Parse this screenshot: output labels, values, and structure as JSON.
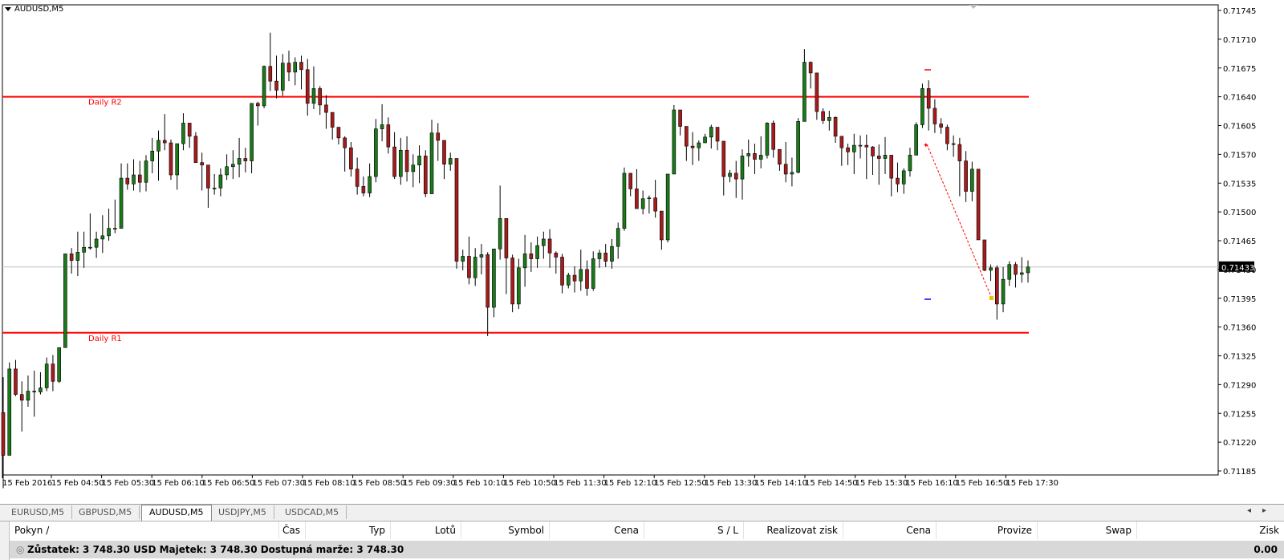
{
  "chart": {
    "symbol_title": "AUDUSD,M5",
    "colors": {
      "bull": "#1a7a1a",
      "bear": "#a61c1c",
      "wick": "#000000",
      "level": "#ff0000",
      "bid_line": "#c0c0c0"
    },
    "price_axis_labels": [
      "0.71745",
      "0.71710",
      "0.71675",
      "0.71640",
      "0.71605",
      "0.71570",
      "0.71535",
      "0.71500",
      "0.71465",
      "0.71430",
      "0.71395",
      "0.71360",
      "0.71325",
      "0.71290",
      "0.71255",
      "0.71220",
      "0.71185"
    ],
    "current_price": "0.71433",
    "time_axis_labels": [
      "15 Feb 2016",
      "15 Feb 04:50",
      "15 Feb 05:30",
      "15 Feb 06:10",
      "15 Feb 06:50",
      "15 Feb 07:30",
      "15 Feb 08:10",
      "15 Feb 08:50",
      "15 Feb 09:30",
      "15 Feb 10:10",
      "15 Feb 10:50",
      "15 Feb 11:30",
      "15 Feb 12:10",
      "15 Feb 12:50",
      "15 Feb 13:30",
      "15 Feb 14:10",
      "15 Feb 14:50",
      "15 Feb 15:30",
      "15 Feb 16:10",
      "15 Feb 16:50",
      "15 Feb 17:30"
    ],
    "levels": [
      {
        "label": "Daily R2",
        "price": 0.7164
      },
      {
        "label": "Daily R1",
        "price": 0.71353
      }
    ],
    "candles": [
      [
        0.71256,
        0.71299,
        0.71164,
        0.71204
      ],
      [
        0.71204,
        0.71317,
        0.71254,
        0.71309
      ],
      [
        0.71309,
        0.7132,
        0.71276,
        0.71278
      ],
      [
        0.71278,
        0.71294,
        0.71233,
        0.71271
      ],
      [
        0.71271,
        0.71301,
        0.71263,
        0.71282
      ],
      [
        0.71282,
        0.71307,
        0.71251,
        0.71281
      ],
      [
        0.71281,
        0.71305,
        0.71278,
        0.71286
      ],
      [
        0.71286,
        0.71323,
        0.71282,
        0.71315
      ],
      [
        0.71315,
        0.71326,
        0.71282,
        0.71294
      ],
      [
        0.71294,
        0.71335,
        0.71292,
        0.71335
      ],
      [
        0.71335,
        0.71449,
        0.71339,
        0.71449
      ],
      [
        0.71449,
        0.71456,
        0.71425,
        0.71441
      ],
      [
        0.71441,
        0.71476,
        0.71422,
        0.71451
      ],
      [
        0.71451,
        0.71476,
        0.71432,
        0.71457
      ],
      [
        0.71457,
        0.71498,
        0.71454,
        0.71457
      ],
      [
        0.71457,
        0.71476,
        0.71444,
        0.71467
      ],
      [
        0.71467,
        0.71496,
        0.7145,
        0.71471
      ],
      [
        0.71471,
        0.71504,
        0.71465,
        0.7148
      ],
      [
        0.7148,
        0.71515,
        0.71474,
        0.7148
      ],
      [
        0.7148,
        0.71559,
        0.7148,
        0.71541
      ],
      [
        0.71541,
        0.71559,
        0.71527,
        0.71534
      ],
      [
        0.71534,
        0.71564,
        0.71526,
        0.71545
      ],
      [
        0.71545,
        0.71562,
        0.71524,
        0.71536
      ],
      [
        0.71536,
        0.71569,
        0.71525,
        0.71562
      ],
      [
        0.71562,
        0.7159,
        0.71547,
        0.71574
      ],
      [
        0.71574,
        0.71599,
        0.71538,
        0.71587
      ],
      [
        0.71587,
        0.71619,
        0.71575,
        0.71584
      ],
      [
        0.71584,
        0.71588,
        0.71539,
        0.71545
      ],
      [
        0.71545,
        0.71579,
        0.71527,
        0.71583
      ],
      [
        0.71583,
        0.7162,
        0.71575,
        0.71608
      ],
      [
        0.71608,
        0.71606,
        0.71578,
        0.71592
      ],
      [
        0.71592,
        0.71597,
        0.71561,
        0.7156
      ],
      [
        0.7156,
        0.71572,
        0.71526,
        0.71557
      ],
      [
        0.71557,
        0.71557,
        0.71505,
        0.71529
      ],
      [
        0.71529,
        0.71546,
        0.71521,
        0.71529
      ],
      [
        0.71529,
        0.71553,
        0.71519,
        0.71545
      ],
      [
        0.71545,
        0.7157,
        0.71539,
        0.71555
      ],
      [
        0.71555,
        0.71575,
        0.7154,
        0.71558
      ],
      [
        0.71558,
        0.7159,
        0.71542,
        0.71565
      ],
      [
        0.71565,
        0.71578,
        0.71548,
        0.71562
      ],
      [
        0.71562,
        0.71598,
        0.71547,
        0.71632
      ],
      [
        0.71632,
        0.71634,
        0.71605,
        0.71629
      ],
      [
        0.71629,
        0.71678,
        0.71626,
        0.71677
      ],
      [
        0.71677,
        0.71718,
        0.71647,
        0.71659
      ],
      [
        0.71659,
        0.7169,
        0.71638,
        0.71648
      ],
      [
        0.71648,
        0.71692,
        0.71641,
        0.71681
      ],
      [
        0.71681,
        0.71696,
        0.71659,
        0.7167
      ],
      [
        0.7167,
        0.71688,
        0.71654,
        0.71682
      ],
      [
        0.71682,
        0.7169,
        0.71649,
        0.71673
      ],
      [
        0.71673,
        0.71686,
        0.71617,
        0.71632
      ],
      [
        0.71632,
        0.71677,
        0.71625,
        0.7165
      ],
      [
        0.7165,
        0.71653,
        0.71618,
        0.7163
      ],
      [
        0.7163,
        0.71642,
        0.71601,
        0.71621
      ],
      [
        0.71621,
        0.71618,
        0.71588,
        0.71603
      ],
      [
        0.71603,
        0.71598,
        0.71582,
        0.7159
      ],
      [
        0.7159,
        0.71592,
        0.71549,
        0.71578
      ],
      [
        0.71578,
        0.71585,
        0.71543,
        0.71552
      ],
      [
        0.71552,
        0.71566,
        0.71521,
        0.71531
      ],
      [
        0.71531,
        0.71543,
        0.71519,
        0.71523
      ],
      [
        0.71523,
        0.71559,
        0.71518,
        0.71543
      ],
      [
        0.71543,
        0.71613,
        0.71536,
        0.71601
      ],
      [
        0.71601,
        0.71631,
        0.71586,
        0.71606
      ],
      [
        0.71606,
        0.71615,
        0.71571,
        0.71579
      ],
      [
        0.71579,
        0.71597,
        0.7154,
        0.71543
      ],
      [
        0.71543,
        0.7159,
        0.71533,
        0.71575
      ],
      [
        0.71575,
        0.71592,
        0.71537,
        0.71549
      ],
      [
        0.71549,
        0.7157,
        0.7153,
        0.71557
      ],
      [
        0.71557,
        0.71581,
        0.71535,
        0.71568
      ],
      [
        0.71568,
        0.71575,
        0.71518,
        0.71522
      ],
      [
        0.71522,
        0.71612,
        0.71527,
        0.71596
      ],
      [
        0.71596,
        0.71608,
        0.71562,
        0.71587
      ],
      [
        0.71587,
        0.71568,
        0.7154,
        0.71558
      ],
      [
        0.71558,
        0.71572,
        0.7155,
        0.71565
      ],
      [
        0.71565,
        0.71563,
        0.71431,
        0.7144
      ],
      [
        0.7144,
        0.71454,
        0.71429,
        0.71446
      ],
      [
        0.71446,
        0.7147,
        0.71412,
        0.7142
      ],
      [
        0.7142,
        0.71456,
        0.7141,
        0.71445
      ],
      [
        0.71445,
        0.71461,
        0.71424,
        0.71448
      ],
      [
        0.71448,
        0.71451,
        0.71349,
        0.71384
      ],
      [
        0.71384,
        0.7145,
        0.71372,
        0.71455
      ],
      [
        0.71455,
        0.71532,
        0.71442,
        0.71492
      ],
      [
        0.71492,
        0.71488,
        0.714,
        0.71444
      ],
      [
        0.71444,
        0.71448,
        0.71378,
        0.71388
      ],
      [
        0.71388,
        0.71443,
        0.71382,
        0.71432
      ],
      [
        0.71432,
        0.71472,
        0.71409,
        0.71449
      ],
      [
        0.71449,
        0.71463,
        0.71427,
        0.71443
      ],
      [
        0.71443,
        0.7147,
        0.71432,
        0.71459
      ],
      [
        0.71459,
        0.71476,
        0.71443,
        0.71467
      ],
      [
        0.71467,
        0.71479,
        0.71432,
        0.7145
      ],
      [
        0.7145,
        0.71452,
        0.71425,
        0.71445
      ],
      [
        0.71445,
        0.71449,
        0.71401,
        0.71411
      ],
      [
        0.71411,
        0.71426,
        0.71407,
        0.71423
      ],
      [
        0.71423,
        0.71434,
        0.71402,
        0.71416
      ],
      [
        0.71416,
        0.71454,
        0.71404,
        0.7143
      ],
      [
        0.7143,
        0.71441,
        0.71398,
        0.71407
      ],
      [
        0.71407,
        0.71452,
        0.71404,
        0.71443
      ],
      [
        0.71443,
        0.71454,
        0.71432,
        0.7145
      ],
      [
        0.7145,
        0.71461,
        0.71433,
        0.7144
      ],
      [
        0.7144,
        0.71467,
        0.71431,
        0.71458
      ],
      [
        0.71458,
        0.71487,
        0.71443,
        0.7148
      ],
      [
        0.7148,
        0.71554,
        0.71477,
        0.71547
      ],
      [
        0.71547,
        0.71544,
        0.71519,
        0.71528
      ],
      [
        0.71528,
        0.71552,
        0.71504,
        0.71504
      ],
      [
        0.71504,
        0.71526,
        0.71497,
        0.71516
      ],
      [
        0.71516,
        0.7152,
        0.71498,
        0.71517
      ],
      [
        0.71517,
        0.71539,
        0.71493,
        0.71501
      ],
      [
        0.71501,
        0.71499,
        0.71454,
        0.71466
      ],
      [
        0.71466,
        0.71546,
        0.71463,
        0.71546
      ],
      [
        0.71546,
        0.7163,
        0.71558,
        0.71624
      ],
      [
        0.71624,
        0.71622,
        0.71593,
        0.71604
      ],
      [
        0.71604,
        0.71587,
        0.71562,
        0.7158
      ],
      [
        0.7158,
        0.71597,
        0.71557,
        0.71578
      ],
      [
        0.71578,
        0.71587,
        0.71562,
        0.71584
      ],
      [
        0.71584,
        0.71595,
        0.71586,
        0.71591
      ],
      [
        0.71591,
        0.71606,
        0.71577,
        0.71603
      ],
      [
        0.71603,
        0.71593,
        0.71575,
        0.71586
      ],
      [
        0.71586,
        0.71578,
        0.7152,
        0.71543
      ],
      [
        0.71543,
        0.71551,
        0.71536,
        0.71547
      ],
      [
        0.71547,
        0.71562,
        0.71517,
        0.7154
      ],
      [
        0.7154,
        0.71576,
        0.71515,
        0.71568
      ],
      [
        0.71568,
        0.71588,
        0.71555,
        0.71571
      ],
      [
        0.71571,
        0.71583,
        0.71546,
        0.71564
      ],
      [
        0.71564,
        0.71592,
        0.71553,
        0.71569
      ],
      [
        0.71569,
        0.71609,
        0.71565,
        0.71608
      ],
      [
        0.71608,
        0.71611,
        0.71566,
        0.71576
      ],
      [
        0.71576,
        0.71575,
        0.7155,
        0.71558
      ],
      [
        0.71558,
        0.71585,
        0.71536,
        0.71546
      ],
      [
        0.71546,
        0.71566,
        0.71531,
        0.71548
      ],
      [
        0.71548,
        0.71614,
        0.71547,
        0.7161
      ],
      [
        0.7161,
        0.71698,
        0.71611,
        0.71682
      ],
      [
        0.71682,
        0.71683,
        0.7165,
        0.71669
      ],
      [
        0.71669,
        0.71638,
        0.71612,
        0.71622
      ],
      [
        0.71622,
        0.71626,
        0.71607,
        0.71611
      ],
      [
        0.71611,
        0.71623,
        0.71599,
        0.71615
      ],
      [
        0.71615,
        0.71616,
        0.71584,
        0.71592
      ],
      [
        0.71592,
        0.71589,
        0.71556,
        0.71578
      ],
      [
        0.71578,
        0.71583,
        0.71557,
        0.71573
      ],
      [
        0.71573,
        0.71595,
        0.71546,
        0.71581
      ],
      [
        0.71581,
        0.71593,
        0.71565,
        0.71581
      ],
      [
        0.71581,
        0.71594,
        0.7154,
        0.71579
      ],
      [
        0.71579,
        0.7158,
        0.71545,
        0.71568
      ],
      [
        0.71568,
        0.71582,
        0.71533,
        0.71565
      ],
      [
        0.71565,
        0.71591,
        0.71546,
        0.71569
      ],
      [
        0.71569,
        0.71565,
        0.71519,
        0.71541
      ],
      [
        0.71541,
        0.7156,
        0.71524,
        0.71534
      ],
      [
        0.71534,
        0.71553,
        0.71522,
        0.7155
      ],
      [
        0.7155,
        0.71578,
        0.71543,
        0.71569
      ],
      [
        0.71569,
        0.71609,
        0.71571,
        0.71606
      ],
      [
        0.71606,
        0.71656,
        0.71602,
        0.7165
      ],
      [
        0.7165,
        0.7166,
        0.71599,
        0.71626
      ],
      [
        0.71626,
        0.71637,
        0.71596,
        0.71607
      ],
      [
        0.71607,
        0.71614,
        0.71595,
        0.71603
      ],
      [
        0.71603,
        0.71606,
        0.71575,
        0.71583
      ],
      [
        0.71583,
        0.71593,
        0.71567,
        0.71582
      ],
      [
        0.71582,
        0.7159,
        0.71519,
        0.71562
      ],
      [
        0.71562,
        0.71574,
        0.71512,
        0.71525
      ],
      [
        0.71525,
        0.71561,
        0.71513,
        0.71552
      ],
      [
        0.71552,
        0.71552,
        0.71467,
        0.71466
      ],
      [
        0.71466,
        0.7146,
        0.71428,
        0.71429
      ],
      [
        0.71429,
        0.71436,
        0.71416,
        0.71432
      ],
      [
        0.71432,
        0.71435,
        0.71369,
        0.71388
      ],
      [
        0.71388,
        0.71433,
        0.71378,
        0.71418
      ],
      [
        0.71418,
        0.7144,
        0.7141,
        0.71436
      ],
      [
        0.71436,
        0.71439,
        0.71408,
        0.71424
      ],
      [
        0.71424,
        0.71445,
        0.71414,
        0.71426
      ],
      [
        0.71426,
        0.71441,
        0.71414,
        0.71433
      ]
    ]
  },
  "tabs": [
    {
      "label": "EURUSD,M5",
      "active": false
    },
    {
      "label": "GBPUSD,M5",
      "active": false
    },
    {
      "label": "AUDUSD,M5",
      "active": true
    },
    {
      "label": "USDJPY,M5",
      "active": false
    },
    {
      "label": "USDCAD,M5",
      "active": false
    }
  ],
  "terminal": {
    "columns": [
      "Pokyn  /",
      "Čas",
      "Typ",
      "Lotů",
      "Symbol",
      "Cena",
      "S / L",
      "Realizovat zisk",
      "Cena",
      "Provize",
      "Swap",
      "Zisk"
    ],
    "balance_text": "Zůstatek: 3 748.30 USD  Majetek: 3 748.30  Dostupná marže: 3 748.30",
    "profit": "0.00"
  }
}
